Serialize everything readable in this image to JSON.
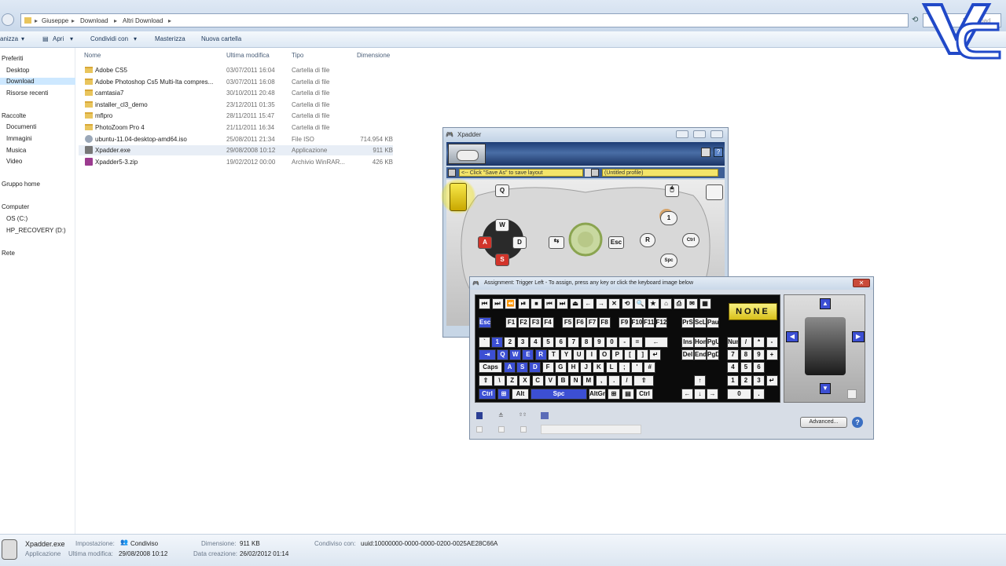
{
  "explorer": {
    "breadcrumb": [
      "Giuseppe",
      "Download",
      "Altri Download"
    ],
    "search_placeholder": "Download",
    "toolbar": {
      "organizza": "anizza",
      "apri": "Apri",
      "condividi": "Condividi con",
      "masterizza": "Masterizza",
      "nuova_cartella": "Nuova cartella"
    },
    "nav": [
      {
        "label": "Preferiti",
        "type": "group"
      },
      {
        "label": "Desktop"
      },
      {
        "label": "Download",
        "selected": true
      },
      {
        "label": "Risorse recenti"
      },
      {
        "label": "Raccolte",
        "type": "group"
      },
      {
        "label": "Documenti"
      },
      {
        "label": "Immagini"
      },
      {
        "label": "Musica"
      },
      {
        "label": "Video"
      },
      {
        "label": "Gruppo home",
        "type": "group"
      },
      {
        "label": "Computer",
        "type": "group"
      },
      {
        "label": "OS (C:)"
      },
      {
        "label": "HP_RECOVERY (D:)"
      },
      {
        "label": "Rete",
        "type": "group"
      }
    ],
    "columns": {
      "name": "Nome",
      "date": "Ultima modifica",
      "type": "Tipo",
      "size": "Dimensione"
    },
    "files": [
      {
        "name": "Adobe CS5",
        "date": "03/07/2011 16:04",
        "type": "Cartella di file",
        "size": "",
        "icon": "folder-icon"
      },
      {
        "name": "Adobe Photoshop Cs5 Multi-Ita compres...",
        "date": "03/07/2011 16:08",
        "type": "Cartella di file",
        "size": "",
        "icon": "folder-icon"
      },
      {
        "name": "camtasia7",
        "date": "30/10/2011 20:48",
        "type": "Cartella di file",
        "size": "",
        "icon": "folder-icon"
      },
      {
        "name": "installer_cl3_demo",
        "date": "23/12/2011 01:35",
        "type": "Cartella di file",
        "size": "",
        "icon": "folder-icon"
      },
      {
        "name": "mflpro",
        "date": "28/11/2011 15:47",
        "type": "Cartella di file",
        "size": "",
        "icon": "folder-icon"
      },
      {
        "name": "PhotoZoom Pro 4",
        "date": "21/11/2011 16:34",
        "type": "Cartella di file",
        "size": "",
        "icon": "folder-icon"
      },
      {
        "name": "ubuntu-11.04-desktop-amd64.iso",
        "date": "25/08/2011 21:34",
        "type": "File ISO",
        "size": "714.954 KB",
        "icon": "disc-icon"
      },
      {
        "name": "Xpadder.exe",
        "date": "29/08/2008 10:12",
        "type": "Applicazione",
        "size": "911 KB",
        "icon": "gamepad-icon",
        "selected": true
      },
      {
        "name": "Xpadder5-3.zip",
        "date": "19/02/2012 00:00",
        "type": "Archivio WinRAR...",
        "size": "426 KB",
        "icon": "archive-icon"
      }
    ],
    "status": {
      "filename": "Xpadder.exe",
      "kind": "Applicazione",
      "impostazione_label": "Impostazione:",
      "impostazione_value": "Condiviso",
      "ultima_label": "Ultima modifica:",
      "ultima_value": "29/08/2008 10:12",
      "dimensione_label": "Dimensione:",
      "dimensione_value": "911 KB",
      "creazione_label": "Data creazione:",
      "creazione_value": "26/02/2012 01:14",
      "condiviso_label": "Condiviso con:",
      "condiviso_value": "uuid:10000000-0000-0000-0200-0025AE28C66A"
    }
  },
  "logo": {
    "text": "VC"
  },
  "xpadder": {
    "title": "Xpadder",
    "layout_field": "<-- Click \"Save As\" to save layout",
    "profile_field": "(Untitled profile)",
    "controller_labels": {
      "q": "Q",
      "w": "W",
      "a": "A",
      "s": "S",
      "d": "D",
      "esc": "Esc",
      "r": "R",
      "one": "1",
      "ctrl": "Ctrl",
      "spc": "Spc"
    }
  },
  "assignment": {
    "title": "Assignment: Trigger Left - To assign, press any key or click the keyboard image below",
    "none_label": "NONE",
    "advanced_label": "Advanced...",
    "help_label": "?",
    "keys": {
      "esc": "Esc",
      "f_keys": [
        "F1",
        "F2",
        "F3",
        "F4",
        "F5",
        "F6",
        "F7",
        "F8",
        "F9",
        "F10",
        "F11",
        "F12"
      ],
      "number_row": [
        "`",
        "1",
        "2",
        "3",
        "4",
        "5",
        "6",
        "7",
        "8",
        "9",
        "0",
        "-",
        "=",
        "←"
      ],
      "q_row": [
        "⇥",
        "Q",
        "W",
        "E",
        "R",
        "T",
        "Y",
        "U",
        "I",
        "O",
        "P",
        "[",
        "]",
        "↵"
      ],
      "a_row": [
        "Caps",
        "A",
        "S",
        "D",
        "F",
        "G",
        "H",
        "J",
        "K",
        "L",
        ";",
        "'",
        "#"
      ],
      "z_row": [
        "⇧",
        "\\",
        "Z",
        "X",
        "C",
        "V",
        "B",
        "N",
        "M",
        ",",
        ".",
        "/",
        "⇧"
      ],
      "bottom_row": [
        "Ctrl",
        "⊞",
        "Alt",
        "Spc",
        "AltGr",
        "⊞",
        "▤",
        "Ctrl"
      ],
      "nav_keys": [
        "Ins",
        "Home",
        "PgUp",
        "Del",
        "End",
        "PgDn"
      ],
      "numpad": [
        "NumLk",
        "/",
        "*",
        "-",
        "7",
        "8",
        "9",
        "+",
        "4",
        "5",
        "6",
        "1",
        "2",
        "3",
        "↵",
        "0",
        "."
      ],
      "sys_keys": [
        "PrS",
        "ScLk",
        "Paus"
      ]
    }
  }
}
